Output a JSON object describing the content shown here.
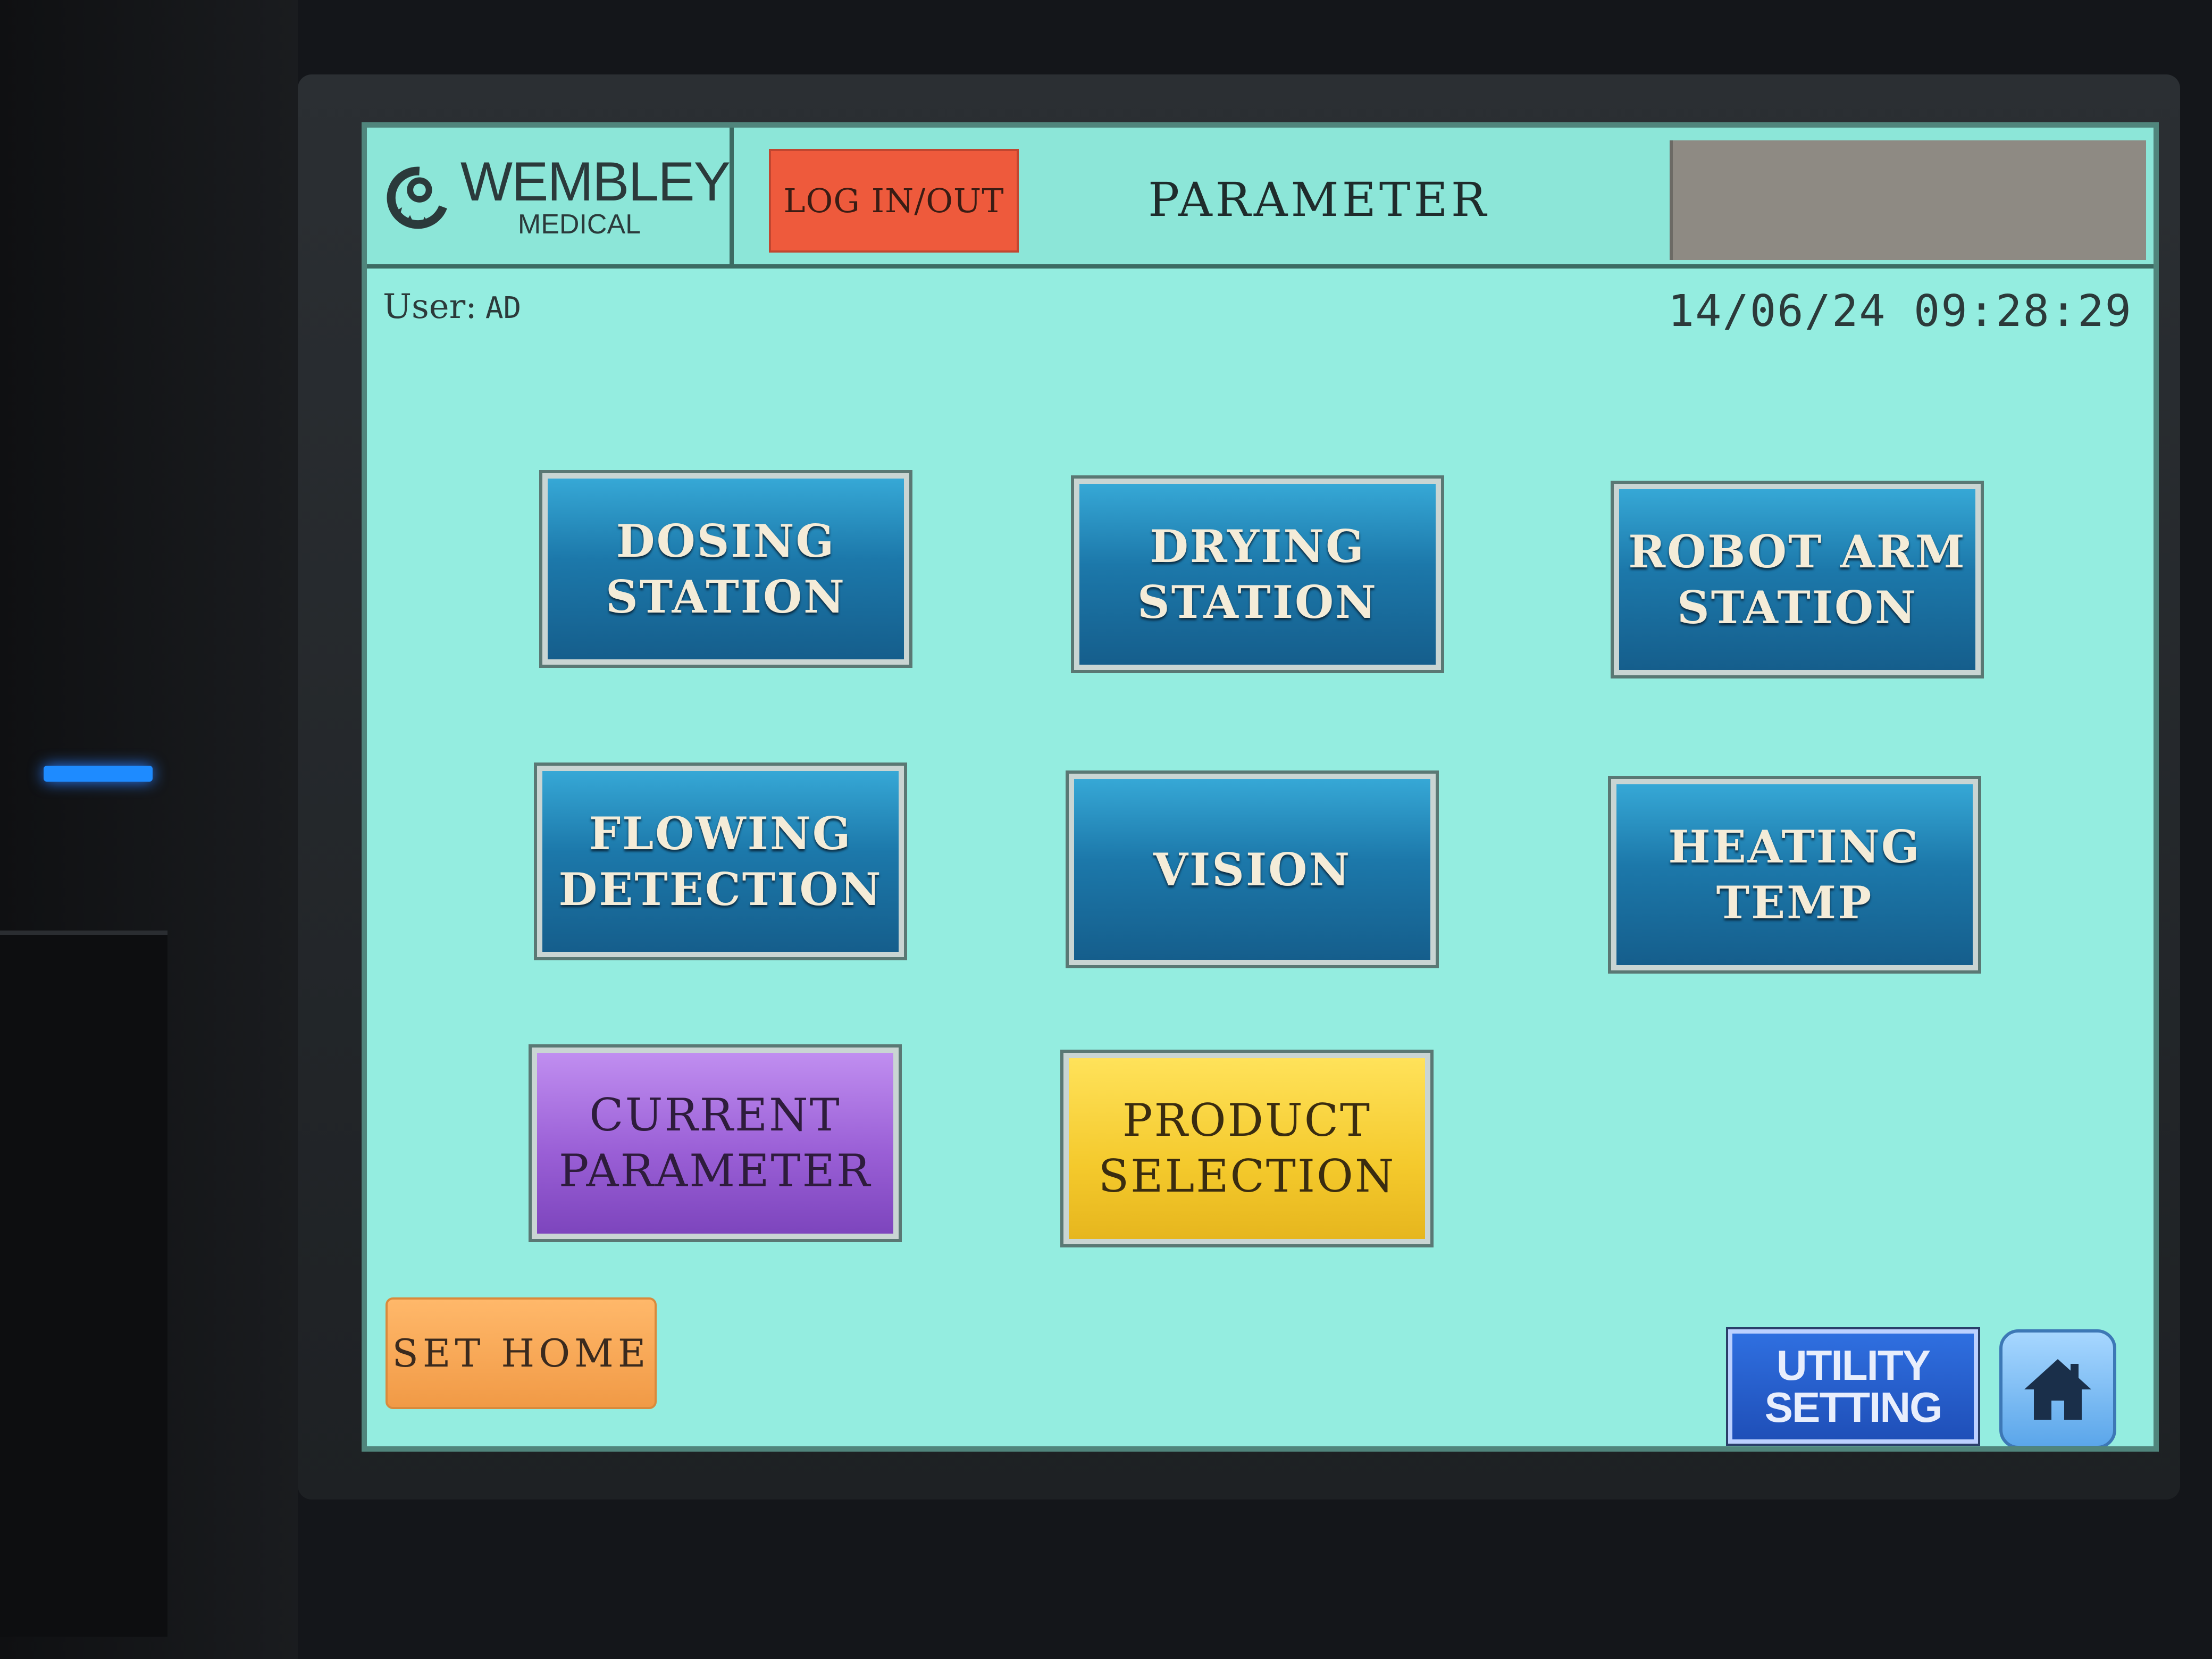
{
  "header": {
    "logo_name": "WEMBLEY",
    "logo_sub": "MEDICAL",
    "login_label": "LOG IN/OUT",
    "title": "PARAMETER"
  },
  "status": {
    "user_label": "User:",
    "user_value": "AD",
    "datetime": "14/06/24 09:28:29"
  },
  "buttons": {
    "dosing": "DOSING\nSTATION",
    "drying": "DRYING\nSTATION",
    "robot_arm": "ROBOT ARM\nSTATION",
    "flowing": "FLOWING\nDETECTION",
    "vision": "VISION",
    "heating": "HEATING\nTEMP",
    "current_parameter": "CURRENT\nPARAMETER",
    "product_selection": "PRODUCT\nSELECTION"
  },
  "footer": {
    "set_home": "SET HOME",
    "utility": "UTILITY\nSETTING",
    "home_icon": "home-icon"
  },
  "colors": {
    "screen_bg": "#94ede0",
    "login": "#ee5a3c",
    "station_blue": "#1c78aa",
    "current_purple": "#9a5fd6",
    "product_yellow": "#f4c92c",
    "set_home_orange": "#f19a46",
    "utility_blue": "#1f4fb8"
  }
}
